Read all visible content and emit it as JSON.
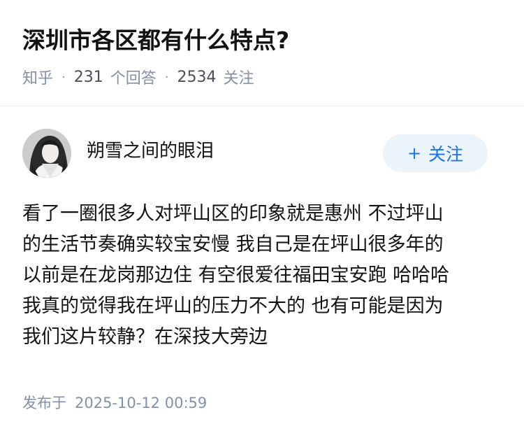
{
  "question": {
    "title": "深圳市各区都有什么特点?",
    "source": "知乎",
    "separator": "·",
    "answer_count": "231",
    "answer_label": "个回答",
    "follower_count": "2534",
    "follower_label": "关注"
  },
  "author": {
    "name": "朔雪之间的眼泪",
    "avatar_icon": "avatar-portrait",
    "follow_icon": "plus-icon",
    "follow_plus": "+",
    "follow_label": "关注"
  },
  "answer": {
    "lines": [
      "看了一圈很多人对坪山区的印象就是惠州 不过坪山",
      "的生活节奏确实较宝安慢 我自己是在坪山很多年的",
      "以前是在龙岗那边住 有空很爱往福田宝安跑 哈哈哈",
      "我真的觉得我在坪山的压力不大的 也有可能是因为",
      "我们这片较静？在深技大旁边"
    ],
    "published_label": "发布于",
    "published_time": "2025-10-12 00:59"
  },
  "colors": {
    "text_primary": "#121212",
    "text_secondary": "#8590a6",
    "accent": "#1772f6",
    "follow_bg": "#ebf3fb",
    "divider": "#ebebeb"
  }
}
